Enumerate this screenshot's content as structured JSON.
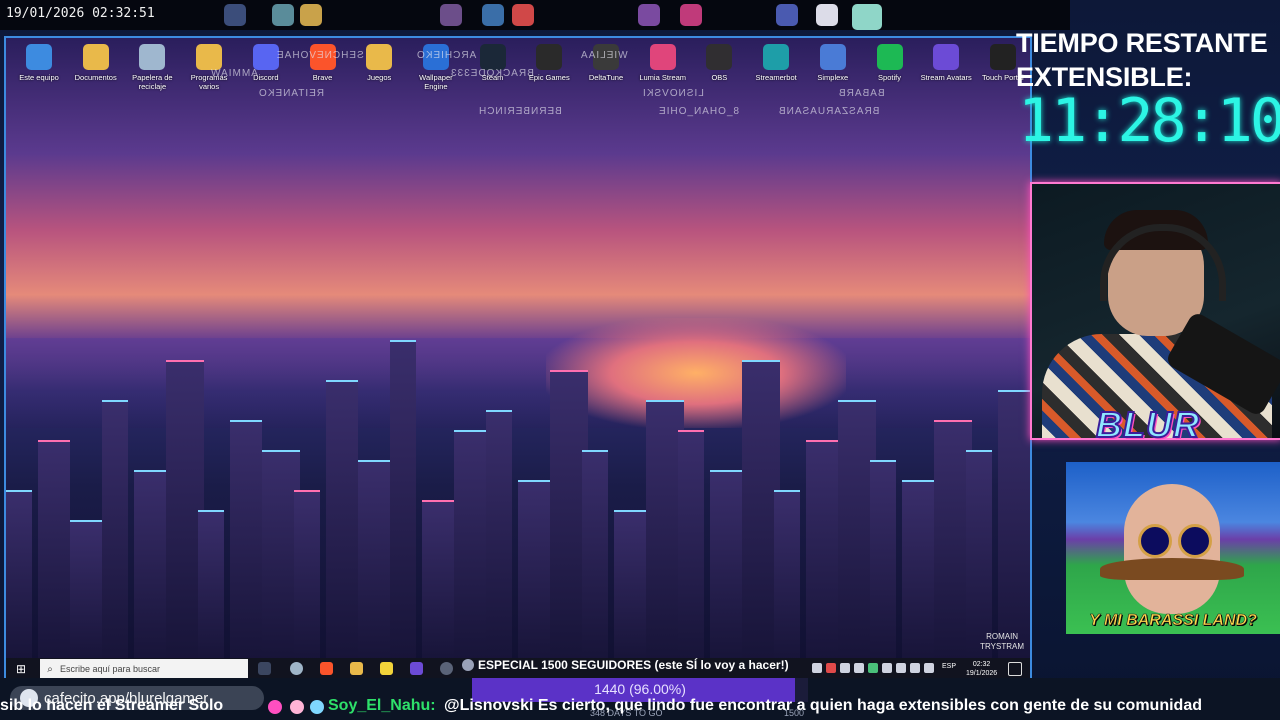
{
  "stream": {
    "datetime": "19/01/2026 02:32:51",
    "timer": {
      "title_line1": "TIEMPO RESTANTE",
      "title_line2": "EXTENSIBLE:",
      "value": "11:28:10"
    },
    "blur_logo": "BLUR",
    "meme_caption": "Y MI BARASSI LAND?",
    "link": "cafecito.app/blurelgamer",
    "goal": {
      "text": "1440 (96.00%)",
      "progress_percent": 96,
      "subtext": "348 DAYS TO GO",
      "target": "1500"
    },
    "chat": {
      "prev_fragment": "sib   lo hacen el Streamer Solo",
      "username": "Soy_El_Nahu:",
      "message": "@Lisnovski Es cierto, que lindo fue encontrar a quien haga extensibles con gente de su comunidad"
    }
  },
  "desktop": {
    "icons": [
      {
        "label": "Este equipo",
        "icon": "computer-icon",
        "color": "#3d8be0"
      },
      {
        "label": "Documentos",
        "icon": "folder-icon",
        "color": "#e9b94a"
      },
      {
        "label": "Papelera de reciclaje",
        "icon": "recycle-bin-icon",
        "color": "#9fb7cf"
      },
      {
        "label": "Programas varios",
        "icon": "folder-icon",
        "color": "#e9b94a"
      },
      {
        "label": "Discord",
        "icon": "discord-icon",
        "color": "#5865f2"
      },
      {
        "label": "Brave",
        "icon": "brave-icon",
        "color": "#fb542b"
      },
      {
        "label": "Juegos",
        "icon": "folder-icon",
        "color": "#e9b94a"
      },
      {
        "label": "Wallpaper Engine",
        "icon": "wallpaper-engine-icon",
        "color": "#2a6fd6"
      },
      {
        "label": "Steam",
        "icon": "steam-icon",
        "color": "#1b2838"
      },
      {
        "label": "Epic Games",
        "icon": "epic-games-icon",
        "color": "#2a2a2a"
      },
      {
        "label": "DeltaTune",
        "icon": "deltatune-icon",
        "color": "#3a3a3a"
      },
      {
        "label": "Lumia Stream",
        "icon": "lumia-stream-icon",
        "color": "#e0457b"
      },
      {
        "label": "OBS",
        "icon": "obs-icon",
        "color": "#302e31"
      },
      {
        "label": "Streamerbot",
        "icon": "streamerbot-icon",
        "color": "#1e9ea8"
      },
      {
        "label": "Simplexe",
        "icon": "simplexe-icon",
        "color": "#4a7bd6"
      },
      {
        "label": "Spotify",
        "icon": "spotify-icon",
        "color": "#1db954"
      },
      {
        "label": "Stream Avatars",
        "icon": "stream-avatars-icon",
        "color": "#6c4bd6"
      },
      {
        "label": "Touch Portal",
        "icon": "touch-portal-icon",
        "color": "#222222"
      }
    ],
    "mirrored_labels": [
      "SEHCNEVOHAE",
      "AMMIAW",
      "REITANEKO",
      "BRACKODE333",
      "ARCHIEKO",
      "WIELIAA",
      "LISNOVSKI",
      "BERNBERINCH",
      "8_OHAN_OHIE",
      "BABARB",
      "BRASZARUASANB"
    ],
    "wallpaper_credit": "ROMAIN\nTRYSTRAM"
  },
  "taskbar": {
    "search_placeholder": "Escribe aquí para buscar",
    "window_title": "ESPECIAL 1500 SEGUIDORES (este SÍ lo voy a hacer!)",
    "lang": "ESP",
    "time": "02:32",
    "date": "19/1/2026"
  },
  "colors": {
    "timer": "#2cf5e4",
    "cam_border": "#ff79d1",
    "chat_user": "#2ee06a",
    "goal_fill": "#5b32c7"
  }
}
